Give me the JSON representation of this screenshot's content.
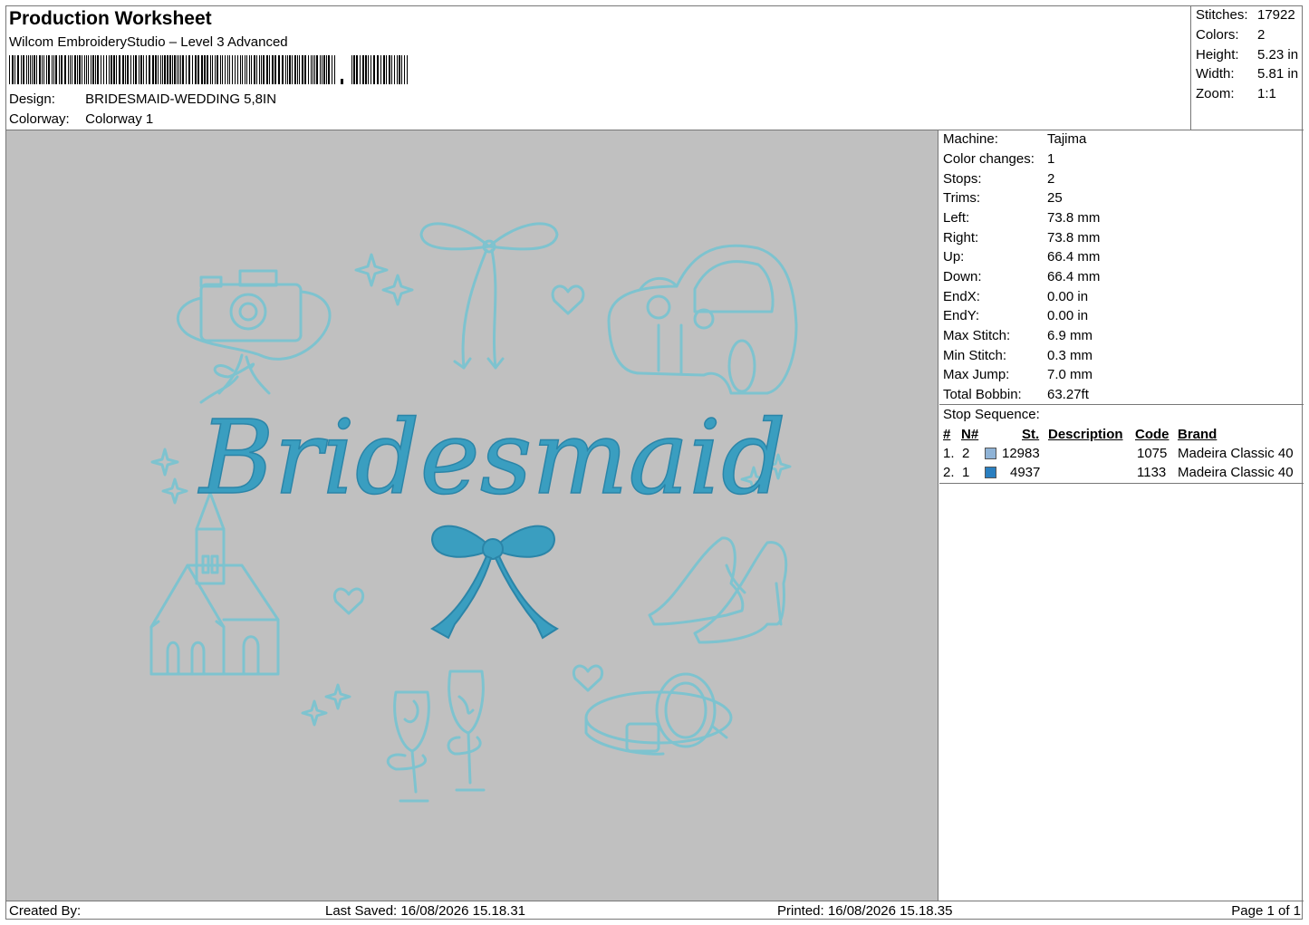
{
  "header": {
    "title": "Production Worksheet",
    "software": "Wilcom EmbroideryStudio – Level 3 Advanced",
    "design_label": "Design:",
    "design_value": "BRIDESMAID-WEDDING 5,8IN",
    "colorway_label": "Colorway:",
    "colorway_value": "Colorway 1"
  },
  "summary": [
    {
      "label": "Stitches:",
      "value": "17922"
    },
    {
      "label": "Colors:",
      "value": "2"
    },
    {
      "label": "Height:",
      "value": "5.23 in"
    },
    {
      "label": "Width:",
      "value": "5.81 in"
    },
    {
      "label": "Zoom:",
      "value": "1:1"
    }
  ],
  "machine_info": [
    {
      "label": "Machine:",
      "value": "Tajima"
    },
    {
      "label": "Color changes:",
      "value": "1"
    },
    {
      "label": "Stops:",
      "value": "2"
    },
    {
      "label": "Trims:",
      "value": "25"
    },
    {
      "label": "Left:",
      "value": "73.8 mm"
    },
    {
      "label": "Right:",
      "value": "73.8 mm"
    },
    {
      "label": "Up:",
      "value": "66.4 mm"
    },
    {
      "label": "Down:",
      "value": "66.4 mm"
    },
    {
      "label": "EndX:",
      "value": "0.00 in"
    },
    {
      "label": "EndY:",
      "value": "0.00 in"
    },
    {
      "label": "Max Stitch:",
      "value": "6.9 mm"
    },
    {
      "label": "Min Stitch:",
      "value": "0.3 mm"
    },
    {
      "label": "Max Jump:",
      "value": "7.0 mm"
    },
    {
      "label": "Total Bobbin:",
      "value": "63.27ft"
    }
  ],
  "stop_sequence": {
    "title": "Stop Sequence:",
    "columns": [
      "#",
      "N#",
      "St.",
      "Description",
      "Code",
      "Brand"
    ],
    "rows": [
      {
        "num": "1.",
        "n": "2",
        "color": "#8fb3d6",
        "st": "12983",
        "description": "",
        "code": "1075",
        "brand": "Madeira Classic 40"
      },
      {
        "num": "2.",
        "n": "1",
        "color": "#2a7fc0",
        "st": "4937",
        "description": "",
        "code": "1133",
        "brand": "Madeira Classic 40"
      }
    ]
  },
  "design": {
    "text": "Bridesmaid",
    "outline_color": "#7ec3cf",
    "fill_color": "#3a9ec0",
    "background": "#c0c0c0"
  },
  "footer": {
    "created_by": "Created By:",
    "last_saved": "Last Saved: 16/08/2026 15.18.31",
    "printed": "Printed: 16/08/2026 15.18.35",
    "page": "Page 1 of 1"
  }
}
